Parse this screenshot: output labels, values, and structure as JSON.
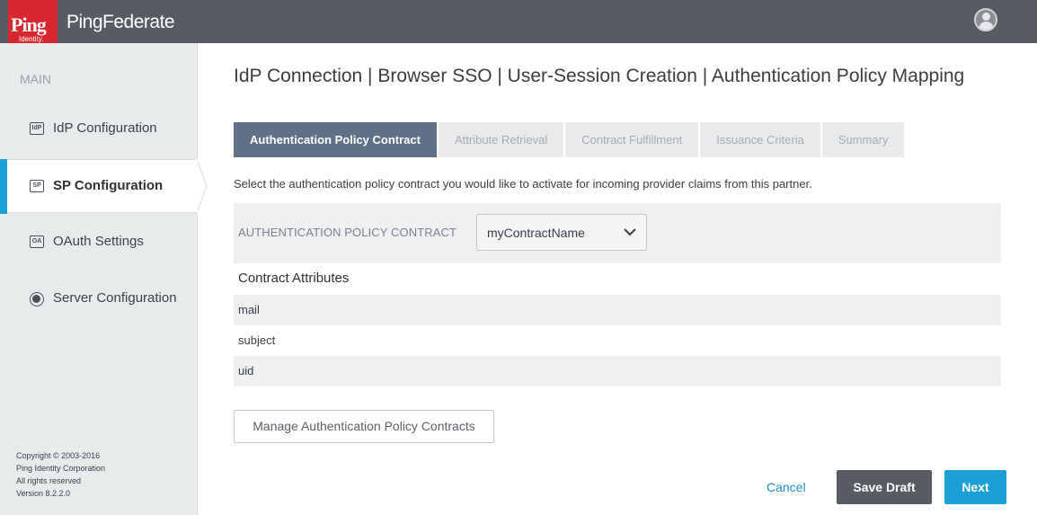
{
  "header": {
    "logo": {
      "brand": "Ping",
      "sub": "Identity."
    },
    "product_name": "PingFederate",
    "user_icon": "user-avatar-icon"
  },
  "sidebar": {
    "section_label": "MAIN",
    "items": [
      {
        "label": "IdP Configuration",
        "icon": "IdP",
        "active": false
      },
      {
        "label": "SP Configuration",
        "icon": "SP",
        "active": true
      },
      {
        "label": "OAuth Settings",
        "icon": "OA",
        "active": false
      },
      {
        "label": "Server Configuration",
        "icon": "server-icon",
        "active": false
      }
    ],
    "copyright": [
      "Copyright © 2003-2016",
      "Ping Identity Corporation",
      "All rights reserved",
      "Version 8.2.2.0"
    ]
  },
  "main": {
    "title": "IdP Connection | Browser SSO | User-Session Creation | Authentication Policy Mapping",
    "tabs": [
      {
        "label": "Authentication Policy Contract",
        "active": true
      },
      {
        "label": "Attribute Retrieval",
        "active": false
      },
      {
        "label": "Contract Fulfillment",
        "active": false
      },
      {
        "label": "Issuance Criteria",
        "active": false
      },
      {
        "label": "Summary",
        "active": false
      }
    ],
    "instruction": "Select the authentication policy contract you would like to activate for incoming provider claims from this partner.",
    "contract": {
      "label": "AUTHENTICATION POLICY CONTRACT",
      "selected": "myContractName"
    },
    "attributes_heading": "Contract Attributes",
    "attributes": [
      "mail",
      "subject",
      "uid"
    ],
    "manage_button": "Manage Authentication Policy Contracts"
  },
  "footer": {
    "cancel": "Cancel",
    "save_draft": "Save Draft",
    "next": "Next"
  },
  "colors": {
    "header_bg": "#575c63",
    "brand_red": "#d8272e",
    "accent_blue": "#1a9fd7",
    "active_tab": "#5f7186",
    "sidebar_bg": "#e8ebec"
  }
}
